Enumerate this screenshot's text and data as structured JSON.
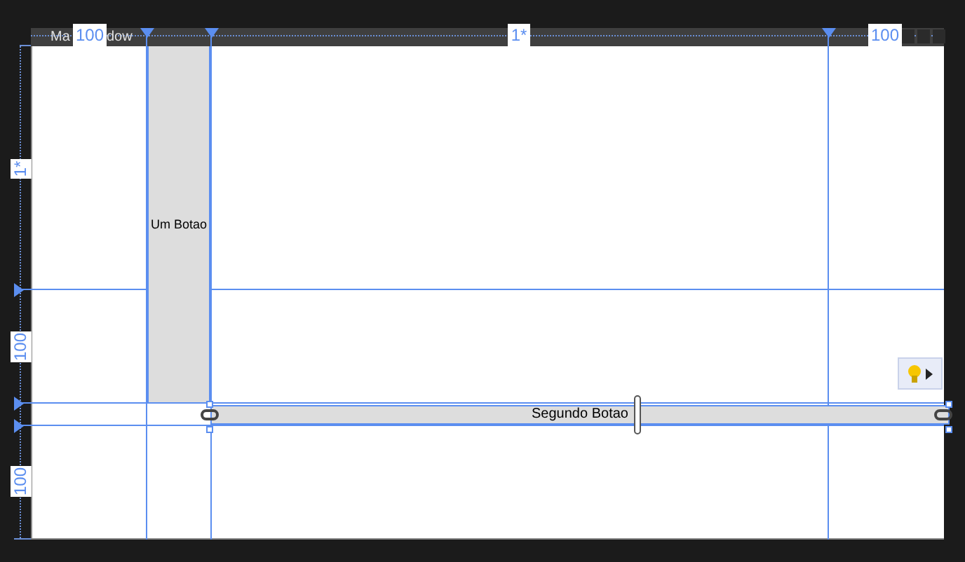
{
  "window": {
    "title_parts": [
      "Ma",
      "dow"
    ]
  },
  "column_definitions": [
    {
      "label": "100"
    },
    {
      "label": "1*"
    },
    {
      "label": "100"
    }
  ],
  "row_definitions": [
    {
      "label": "1*"
    },
    {
      "label": "100"
    },
    {
      "label": "100"
    }
  ],
  "buttons": [
    {
      "kind": "tall",
      "label": "Um Botao",
      "selected": false
    },
    {
      "kind": "wide",
      "label": "Segundo Botao",
      "selected": true
    }
  ]
}
